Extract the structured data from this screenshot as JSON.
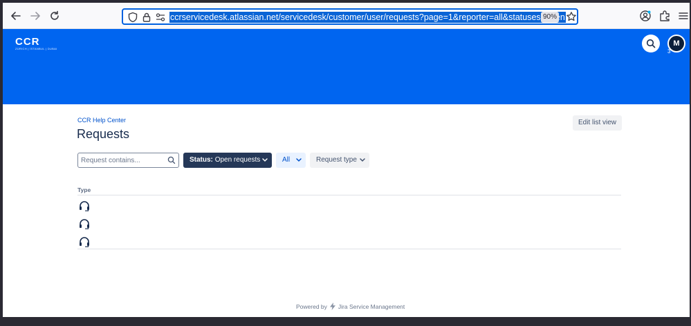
{
  "browser": {
    "url": "ccrservicedesk.atlassian.net/servicedesk/customer/user/requests?page=1&reporter=all&statuses=open",
    "zoom": "90%"
  },
  "header": {
    "logo_text": "CCR",
    "logo_subtext": "ZÜRICH | İSTANBUL | DUBAI",
    "avatar_initial": "M",
    "avatar_badge": "3",
    "brand_color": "#0065f0"
  },
  "breadcrumb": "CCR Help Center",
  "title": "Requests",
  "edit_button": "Edit list view",
  "search": {
    "placeholder": "Request contains..."
  },
  "filters": {
    "status_label": "Status:",
    "status_value": "Open requests",
    "reporter": "All",
    "request_type": "Request type"
  },
  "table": {
    "columns": [
      "Type"
    ],
    "rows": [
      {
        "type_icon": "headset-icon"
      },
      {
        "type_icon": "headset-icon"
      },
      {
        "type_icon": "headset-icon"
      }
    ]
  },
  "footer": {
    "powered_by": "Powered by",
    "product": "Jira Service Management"
  }
}
